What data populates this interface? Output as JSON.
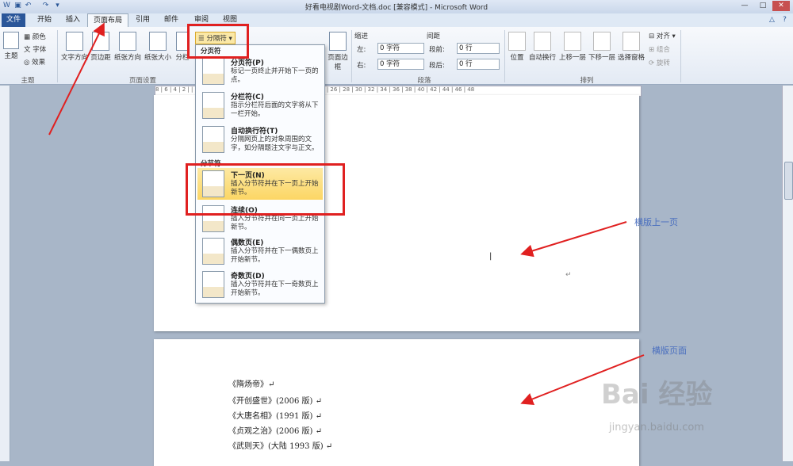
{
  "window": {
    "title": "好看电视剧Word-文档.doc [兼容模式] - Microsoft Word",
    "min": "—",
    "max": "□",
    "close": "✕"
  },
  "tabs": [
    "文件",
    "开始",
    "插入",
    "页面布局",
    "引用",
    "邮件",
    "审阅",
    "视图"
  ],
  "ribbon": {
    "theme": {
      "main": "主题",
      "colors": "颜色",
      "fonts": "字体",
      "effects": "效果",
      "group": "主题"
    },
    "page_setup": {
      "text_dir": "文字方向",
      "margins": "页边距",
      "orientation": "纸张方向",
      "size": "纸张大小",
      "columns": "分栏",
      "breaks": "分隔符",
      "group": "页面设置"
    },
    "page_bg": {
      "border": "页面边框"
    },
    "paragraph": {
      "indent": "缩进",
      "left": "左:",
      "right": "右:",
      "left_val": "0 字符",
      "right_val": "0 字符",
      "spacing": "间距",
      "before": "段前:",
      "after": "段后:",
      "before_val": "0 行",
      "after_val": "0 行",
      "group": "段落"
    },
    "arrange": {
      "position": "位置",
      "wrap": "自动换行",
      "forward": "上移一层",
      "backward": "下移一层",
      "pane": "选择窗格",
      "align": "对齐",
      "group_btn": "组合",
      "rotate": "旋转",
      "group": "排列"
    }
  },
  "dropdown": {
    "header1": "分页符",
    "header2": "分节符",
    "items": [
      {
        "title": "分页符(P)",
        "desc": "标记一页终止并开始下一页的点。"
      },
      {
        "title": "分栏符(C)",
        "desc": "指示分栏符后面的文字将从下一栏开始。"
      },
      {
        "title": "自动换行符(T)",
        "desc": "分隔网页上的对象周围的文字，如分隔题注文字与正文。"
      },
      {
        "title": "下一页(N)",
        "desc": "插入分节符并在下一页上开始新节。"
      },
      {
        "title": "连续(O)",
        "desc": "插入分节符并在同一页上开始新节。"
      },
      {
        "title": "偶数页(E)",
        "desc": "插入分节符并在下一偶数页上开始新节。"
      },
      {
        "title": "奇数页(D)",
        "desc": "插入分节符并在下一奇数页上开始新节。"
      }
    ]
  },
  "ruler": "8 | 6 | 4 | 2 | | 2 | 4 | 6 | 8 | 10 | 12 | 14 | 16 | 18 | 20 | 22 | 24 | 26 | 28 | 30 | 32 | 34 | 36 | 38 | 40 | 42 | 44 | 46 | 48",
  "annotations": {
    "landscape_prev": "横版上一页",
    "landscape_page": "横版页面"
  },
  "document": {
    "mark": "↵",
    "books": [
      "《隋炀帝》↵",
      "《开创盛世》(2006 版) ↵",
      "《大唐名相》(1991 版) ↵",
      "《贞观之治》(2006 版) ↵",
      "《武则天》(大陆 1993 版) ↵"
    ]
  },
  "watermark": {
    "main": "Bai 经验",
    "sub": "jingyan.baidu.com"
  },
  "colors": {
    "accent": "#2a5699",
    "highlight": "#e02020",
    "annotation": "#4a6fbf"
  }
}
